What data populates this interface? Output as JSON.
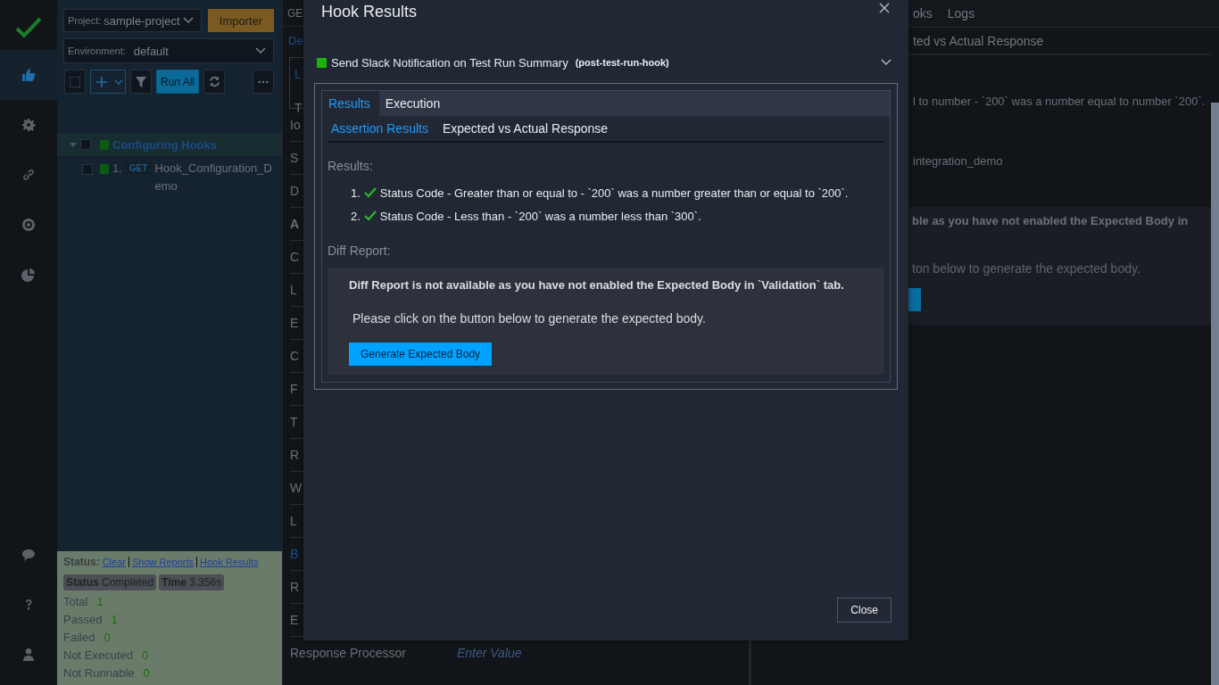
{
  "nav": {
    "top": [
      {
        "kind": "thumbs",
        "selected": true
      },
      {
        "kind": "gear",
        "selected": false
      },
      {
        "kind": "link",
        "selected": false
      },
      {
        "kind": "target",
        "selected": false
      },
      {
        "kind": "pie",
        "selected": false
      }
    ],
    "bottom": [
      {
        "kind": "chat",
        "selected": false
      },
      {
        "kind": "help",
        "selected": false
      },
      {
        "kind": "user",
        "selected": false
      }
    ]
  },
  "sidebar": {
    "project": {
      "label": "Project:",
      "value": "sample-project"
    },
    "import_button": "Importer",
    "environment": {
      "label": "Environment:",
      "value": "default"
    },
    "toolbar": {
      "select_all_checked": false,
      "run_all": "Run All"
    },
    "tree": [
      {
        "name": "Configuring Hooks",
        "expanded": true,
        "checked": false,
        "children": [
          {
            "number": "1.",
            "method": "GET",
            "name": "Hook_Configuration_Demo",
            "checked": false
          }
        ]
      }
    ],
    "status": {
      "label": "Status:",
      "links": [
        "Clear",
        "Show Reports",
        "Hook Results"
      ],
      "badges": [
        {
          "label": "Status",
          "value": "Completed"
        },
        {
          "label": "Time",
          "value": "3.356s"
        }
      ],
      "counts": [
        {
          "label": "Total",
          "value": "1"
        },
        {
          "label": "Passed",
          "value": "1"
        },
        {
          "label": "Failed",
          "value": "0"
        },
        {
          "label": "Not Executed",
          "value": "0"
        },
        {
          "label": "Not Runnable",
          "value": "0"
        }
      ]
    }
  },
  "details": {
    "tab": "GE",
    "link": "De",
    "box_lines": [
      {
        "text": "L",
        "kind": "link"
      },
      {
        "text": "T",
        "kind": "text"
      }
    ],
    "fields": [
      {
        "label": "Io",
        "kind": "field"
      },
      {
        "label": "S",
        "kind": "field"
      },
      {
        "label": "D",
        "kind": "field"
      },
      {
        "label": "A",
        "kind": "heading"
      },
      {
        "label": "C",
        "kind": "field"
      },
      {
        "label": "L",
        "kind": "field"
      },
      {
        "label": "E",
        "kind": "field"
      },
      {
        "label": "C",
        "kind": "field"
      },
      {
        "label": "F",
        "kind": "field"
      },
      {
        "label": "T",
        "kind": "field"
      },
      {
        "label": "R",
        "kind": "field"
      },
      {
        "label": "W",
        "kind": "field"
      },
      {
        "label": "L",
        "kind": "field"
      },
      {
        "label": "B",
        "kind": "link"
      },
      {
        "label": "R",
        "kind": "field"
      },
      {
        "label": "E",
        "kind": "field"
      },
      {
        "label": "Response Processor",
        "kind": "field",
        "placeholder": "Enter Value"
      }
    ]
  },
  "results_panel": {
    "tabs": [
      "oks",
      "Logs"
    ],
    "subtab": "ted vs Actual Response",
    "assertion": "l to number - `200` was a number equal to number `200`.",
    "name": "integration_demo",
    "diff_title": "ble as you have not enabled the Expected Body in",
    "diff_text": "ton below to generate the expected body."
  },
  "modal": {
    "title": "Hook Results",
    "hook": {
      "color": "#1db30d",
      "name": "Send Slack Notification on Test Run Summary",
      "id": "(post-test-run-hook)",
      "expanded": true
    },
    "tabs": [
      {
        "label": "Results",
        "selected": true
      },
      {
        "label": "Execution",
        "selected": false
      }
    ],
    "subtabs": [
      {
        "label": "Assertion Results",
        "selected": true
      },
      {
        "label": "Expected vs Actual Response",
        "selected": false
      }
    ],
    "results_label": "Results:",
    "results": [
      {
        "number": "1.",
        "passed": true,
        "text": "Status Code - Greater than or equal to - `200` was a number greater than or equal to `200`."
      },
      {
        "number": "2.",
        "passed": true,
        "text": "Status Code - Less than - `200` was a number less than `300`."
      }
    ],
    "diff_label": "Diff Report:",
    "diff_title": "Diff Report is not available as you have not enabled the Expected Body in `Validation` tab.",
    "diff_text": "Please click on the button below to generate the expected body.",
    "generate_button": "Generate Expected Body",
    "close_button": "Close"
  }
}
